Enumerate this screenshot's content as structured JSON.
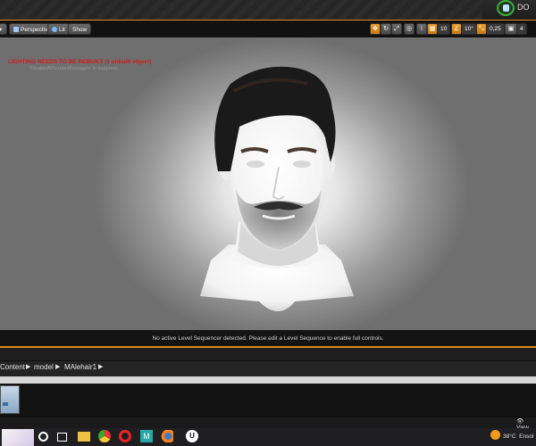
{
  "topbar": {
    "label": "DO"
  },
  "viewport_toolbar": {
    "perspective_label": "Perspective",
    "lit_label": "Lit",
    "show_label": "Show",
    "grid_value": "10",
    "rotation_value": "10°",
    "scale_value": "0,25",
    "camera_speed": "4"
  },
  "viewport": {
    "warning_title": "LIGHTING NEEDS TO BE REBUILT (1 unbuilt object)",
    "warning_hint": "'DisableAllScreenMessages' to suppress"
  },
  "sequencer": {
    "message": "No active Level Sequencer detected. Please edit a Level Sequence to enable full controls."
  },
  "content_browser": {
    "breadcrumbs": [
      "Content",
      "model",
      "MAlehair1"
    ],
    "view_options_label": "View"
  },
  "taskbar": {
    "weather_temp": "38°C",
    "weather_desc": "Ensol"
  },
  "colors": {
    "accent": "#e08a1e",
    "warning": "#d21c1c",
    "source_control_ring": "#3fae3f"
  }
}
